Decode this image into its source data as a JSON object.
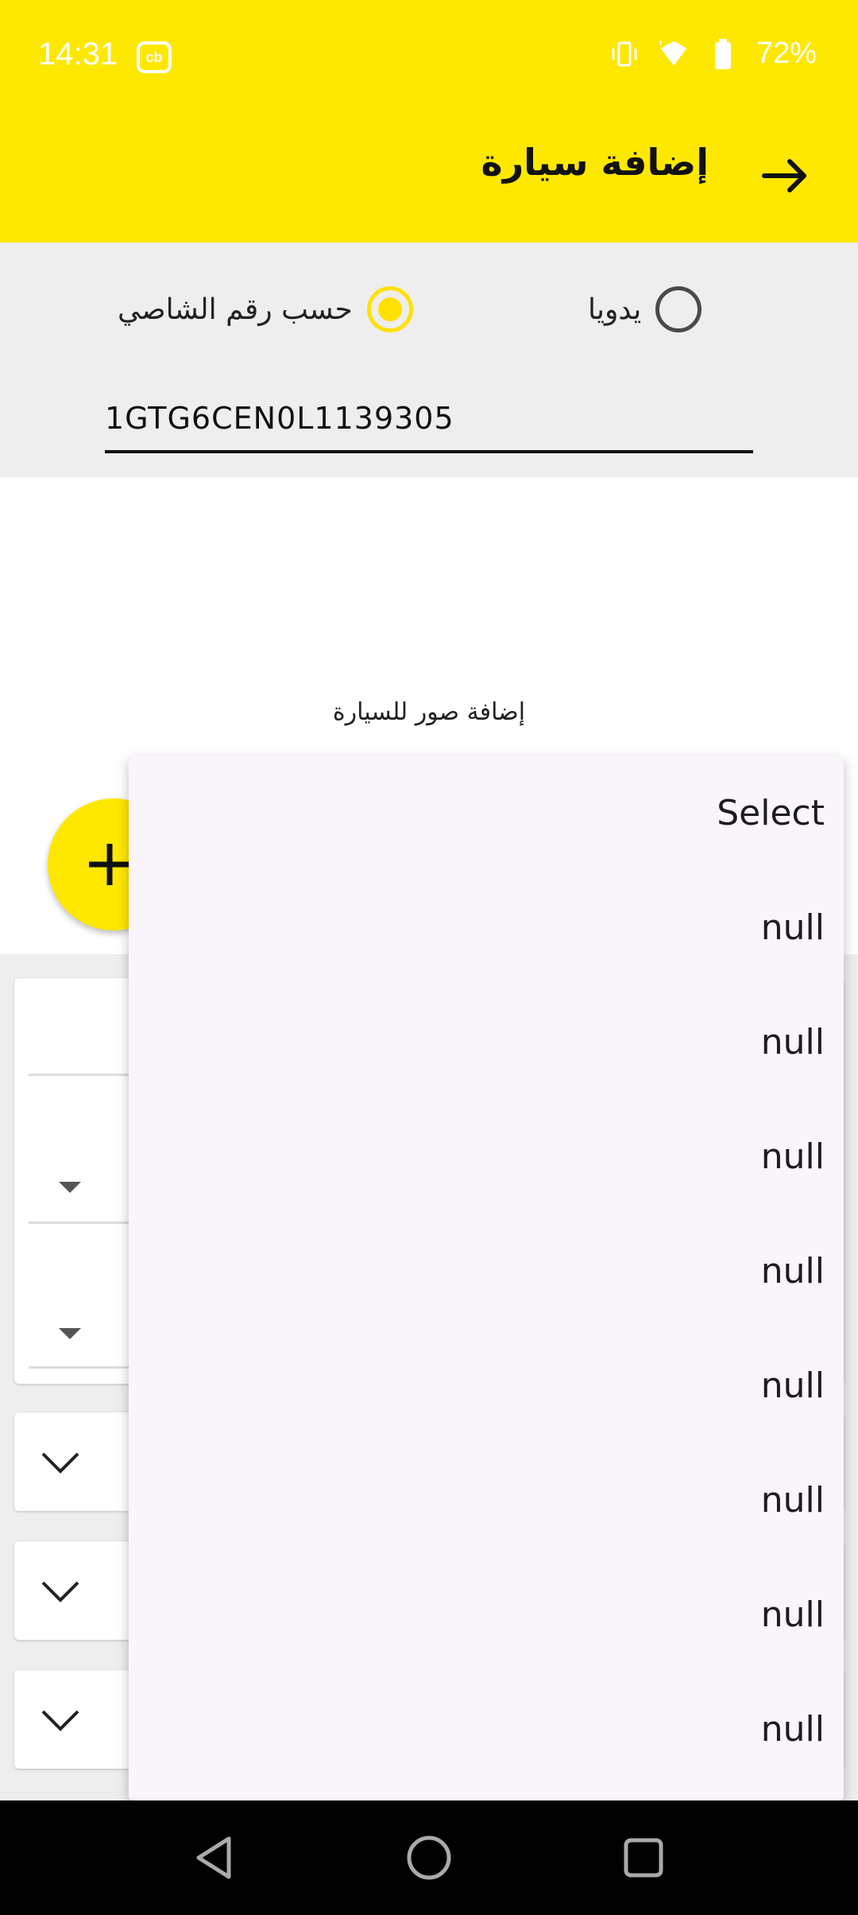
{
  "status_bar": {
    "time": "14:31",
    "badge": "cb",
    "battery": "72%",
    "icons": [
      "vibrate-icon",
      "data-icon",
      "wifi-icon",
      "battery-icon"
    ]
  },
  "app_bar": {
    "title": "إضافة سيارة",
    "back_icon": "arrow-right-icon"
  },
  "options": {
    "radio_manual": "يدويا",
    "radio_chassis": "حسب رقم الشاصي",
    "selected": "radio_chassis",
    "vin_value": "1GTG6CEN0L1139305"
  },
  "photos": {
    "label": "إضافة صور للسيارة",
    "add_icon": "plus-icon"
  },
  "dropdown": {
    "options": [
      "Select",
      "null",
      "null",
      "null",
      "null",
      "null",
      "null",
      "null",
      "null"
    ]
  },
  "colors": {
    "accent": "#FFE800",
    "background": "#EEEEEE",
    "popup": "#FAF4FB"
  },
  "nav": {
    "icons": [
      "back-triangle-icon",
      "home-circle-icon",
      "recents-square-icon"
    ]
  }
}
